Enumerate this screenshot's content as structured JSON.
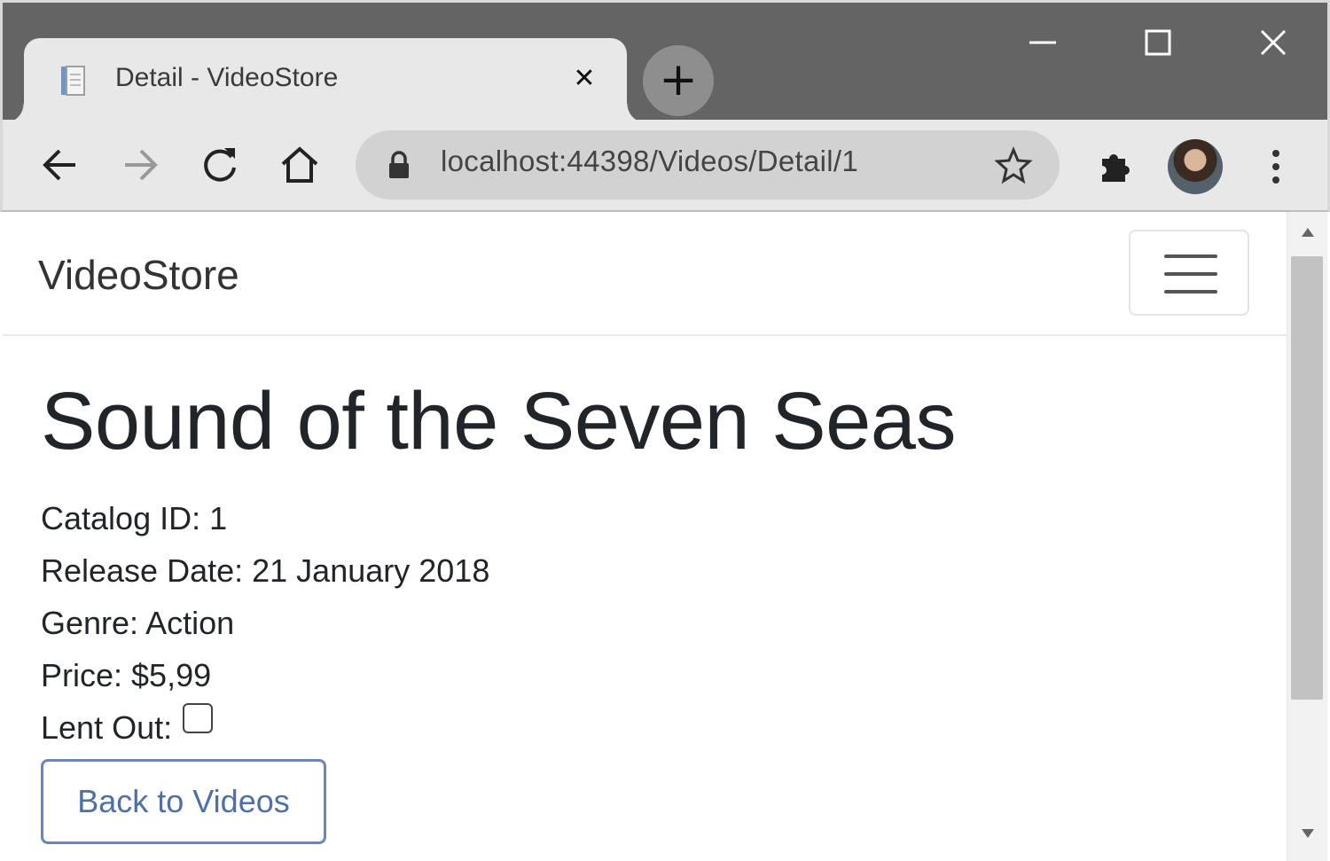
{
  "browser": {
    "tab_title": "Detail - VideoStore",
    "tab_close_glyph": "✕",
    "new_tab_glyph": "+",
    "url": "localhost:44398/Videos/Detail/1",
    "icons": [
      "file-icon",
      "close-icon",
      "plus-icon",
      "minimize-icon",
      "maximize-icon",
      "close-window-icon",
      "back-arrow-icon",
      "forward-arrow-icon",
      "reload-icon",
      "home-icon",
      "lock-icon",
      "star-icon",
      "extensions-icon",
      "avatar",
      "more-vert-icon"
    ]
  },
  "page": {
    "brand": "VideoStore",
    "title": "Sound of the Seven Seas",
    "catalog_id": "Catalog ID: 1",
    "release_date": "Release Date: 21 January 2018",
    "genre": "Genre: Action",
    "price": "Price: $5,99",
    "lent_out_label": "Lent Out:",
    "lent_out_checked": false,
    "back_button": "Back to Videos"
  },
  "colors": {
    "titlebar": "#646464",
    "toolbar": "#e8e8e8",
    "button_border": "#6b85b8",
    "button_text": "#4e6fa8"
  }
}
